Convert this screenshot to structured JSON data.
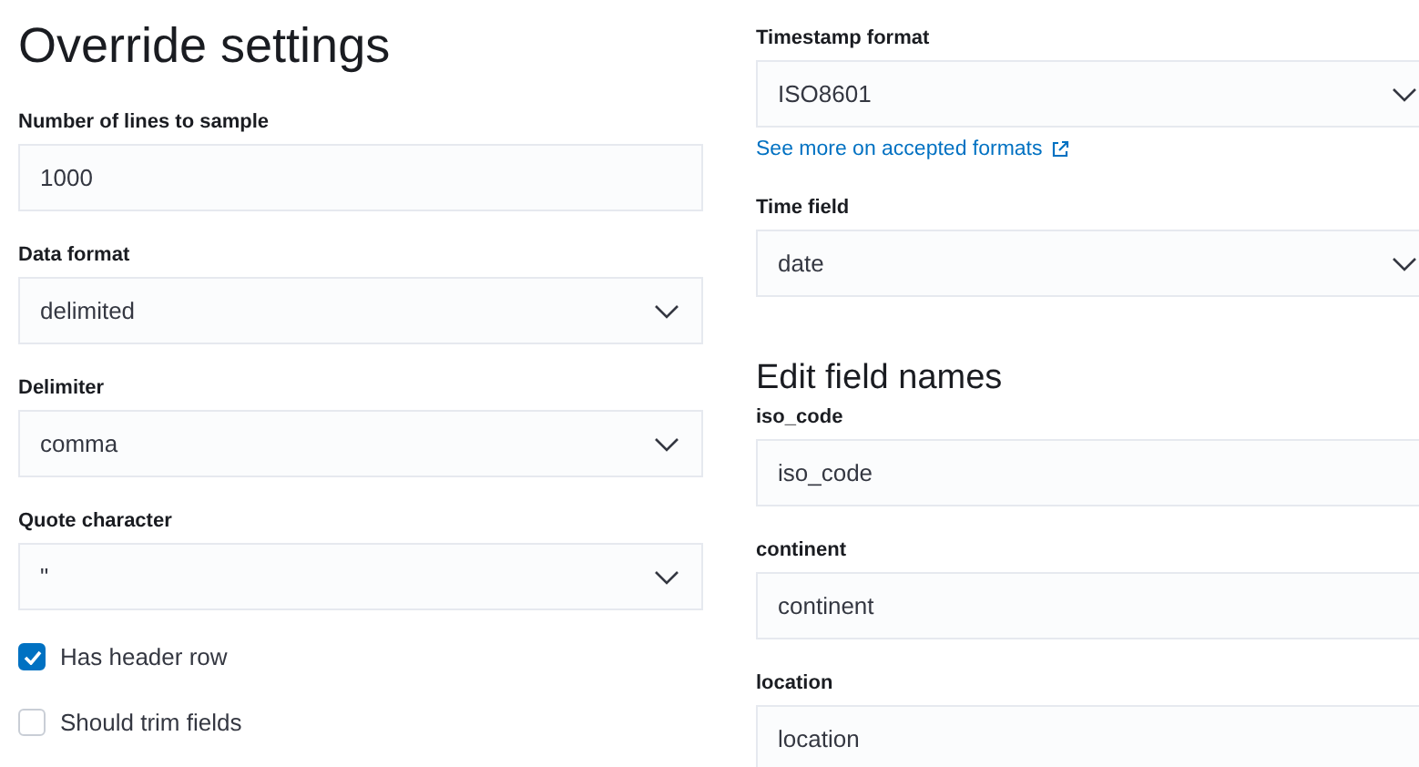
{
  "left": {
    "title": "Override settings",
    "fields": [
      {
        "label": "Number of lines to sample",
        "kind": "text",
        "value": "1000"
      },
      {
        "label": "Data format",
        "kind": "select",
        "value": "delimited"
      },
      {
        "label": "Delimiter",
        "kind": "select",
        "value": "comma"
      },
      {
        "label": "Quote character",
        "kind": "select",
        "value": "\""
      }
    ],
    "checkboxes": [
      {
        "label": "Has header row",
        "checked": true
      },
      {
        "label": "Should trim fields",
        "checked": false
      }
    ]
  },
  "right": {
    "timestamp_format": {
      "label": "Timestamp format",
      "kind": "select",
      "value": "ISO8601"
    },
    "link": "See more on accepted formats",
    "time_field": {
      "label": "Time field",
      "kind": "select",
      "value": "date"
    },
    "heading": "Edit field names",
    "field_names": [
      {
        "label": "iso_code",
        "kind": "text",
        "value": "iso_code"
      },
      {
        "label": "continent",
        "kind": "text",
        "value": "continent"
      },
      {
        "label": "location",
        "kind": "text",
        "value": "location"
      }
    ]
  }
}
